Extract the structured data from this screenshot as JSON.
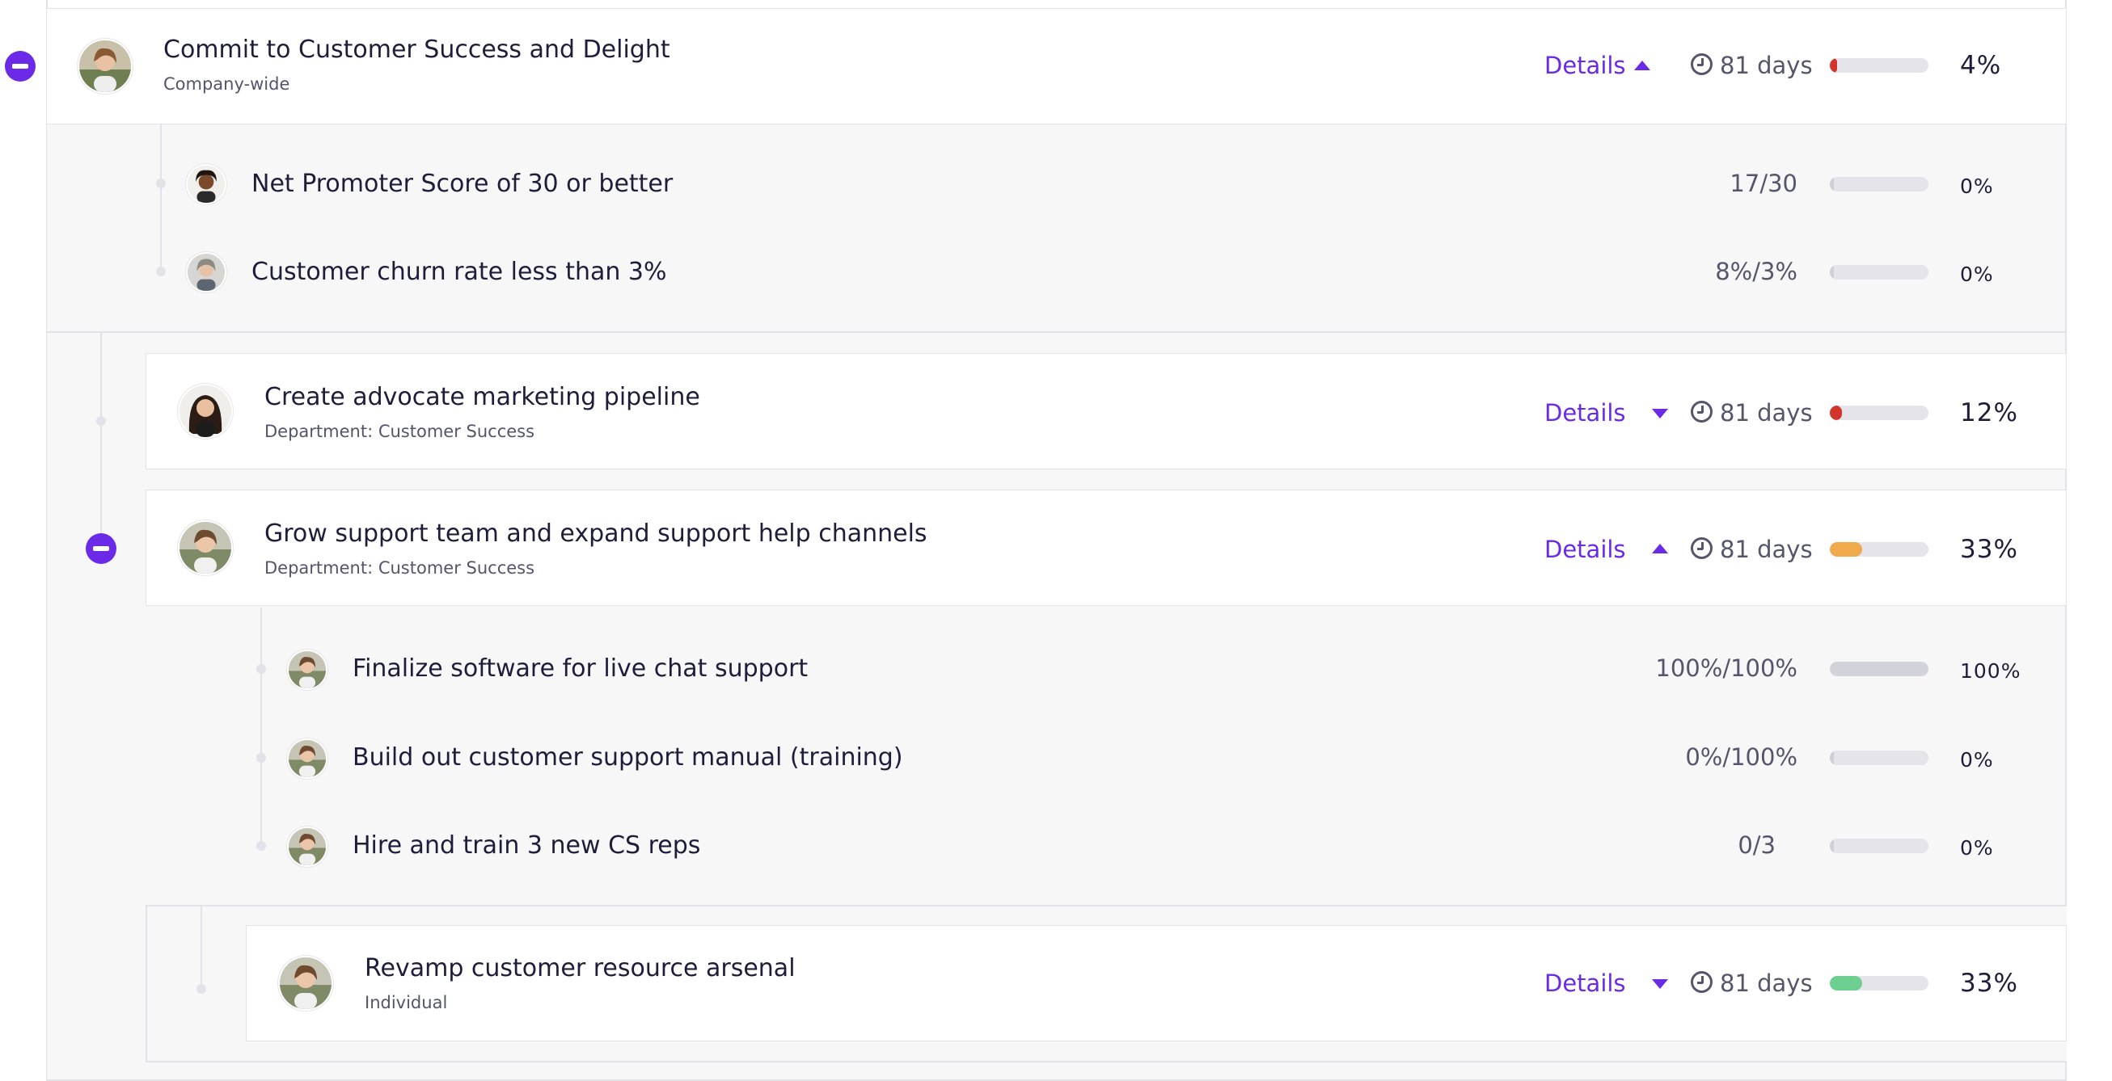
{
  "colors": {
    "accent": "#6a2ae8",
    "red": "#d1352b",
    "orange": "#f0a94b",
    "green": "#6ccf8f",
    "complete": "#d2d2da",
    "track": "#e4e4ea"
  },
  "icons": {
    "collapse": "minus-circle-icon",
    "caret_up": "caret-up-icon",
    "caret_down": "caret-down-icon",
    "clock": "clock-icon"
  },
  "objectives": [
    {
      "title": "Commit to Customer Success and Delight",
      "subtitle": "Company-wide",
      "details_label": "Details",
      "expanded": true,
      "days": "81 days",
      "progress": 0.04,
      "progress_label": "4%",
      "key_results": [
        {
          "title": "Net Promoter Score of 30 or better",
          "metric": "17/30",
          "progress": 0,
          "progress_label": "0%"
        },
        {
          "title": "Customer churn rate less than 3%",
          "metric": "8%/3%",
          "progress": 0,
          "progress_label": "0%"
        }
      ]
    },
    {
      "title": "Create advocate marketing pipeline",
      "subtitle": "Department: Customer Success",
      "details_label": "Details",
      "expanded": false,
      "days": "81 days",
      "progress": 0.12,
      "progress_label": "12%"
    },
    {
      "title": "Grow support team and expand support help channels",
      "subtitle": "Department: Customer Success",
      "details_label": "Details",
      "expanded": true,
      "days": "81 days",
      "progress": 0.33,
      "progress_label": "33%",
      "key_results": [
        {
          "title": "Finalize software for live chat support",
          "metric": "100%/100%",
          "progress": 1.0,
          "progress_label": "100%"
        },
        {
          "title": "Build out customer support manual (training)",
          "metric": "0%/100%",
          "progress": 0,
          "progress_label": "0%"
        },
        {
          "title": "Hire and train 3 new CS reps",
          "metric": "0/3",
          "progress": 0,
          "progress_label": "0%"
        }
      ]
    },
    {
      "title": "Revamp customer resource arsenal",
      "subtitle": "Individual",
      "details_label": "Details",
      "expanded": false,
      "days": "81 days",
      "progress": 0.33,
      "progress_label": "33%"
    }
  ]
}
